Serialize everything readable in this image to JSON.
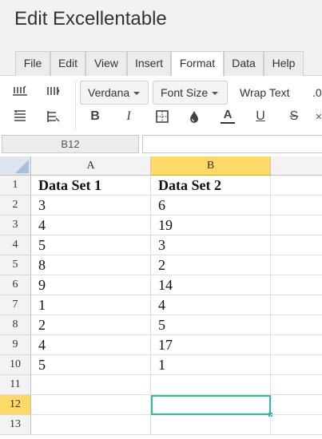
{
  "app": {
    "title": "Edit Excellentable"
  },
  "menu": {
    "tabs": [
      {
        "label": "File"
      },
      {
        "label": "Edit"
      },
      {
        "label": "View"
      },
      {
        "label": "Insert"
      },
      {
        "label": "Format",
        "active": true
      },
      {
        "label": "Data"
      },
      {
        "label": "Help"
      }
    ]
  },
  "toolbar": {
    "font_family": "Verdana",
    "font_size": "Font Size",
    "wrap_text": "Wrap Text",
    "decimal_label": ".0",
    "bold": "B",
    "italic": "I",
    "font_color": "A",
    "underline": "U",
    "strikethrough": "S"
  },
  "formula_bar": {
    "cell_ref": "B12",
    "value": ""
  },
  "sheet": {
    "columns": [
      "A",
      "B"
    ],
    "selected_column": "B",
    "selected_row": 12,
    "row_numbers": [
      "1",
      "2",
      "3",
      "4",
      "5",
      "6",
      "7",
      "8",
      "9",
      "10",
      "11",
      "12",
      "13"
    ],
    "rows": [
      [
        "Data Set 1",
        "Data Set 2"
      ],
      [
        "3",
        "6"
      ],
      [
        "4",
        "19"
      ],
      [
        "5",
        "3"
      ],
      [
        "8",
        "2"
      ],
      [
        "9",
        "14"
      ],
      [
        "1",
        "4"
      ],
      [
        "2",
        "5"
      ],
      [
        "4",
        "17"
      ],
      [
        "5",
        "1"
      ],
      [
        "",
        ""
      ],
      [
        "",
        ""
      ],
      [
        "",
        ""
      ]
    ]
  },
  "colors": {
    "selected_header": "#ffd966",
    "active_cell_border": "#2bbf9f",
    "chrome_background": "#f2f2f2"
  }
}
